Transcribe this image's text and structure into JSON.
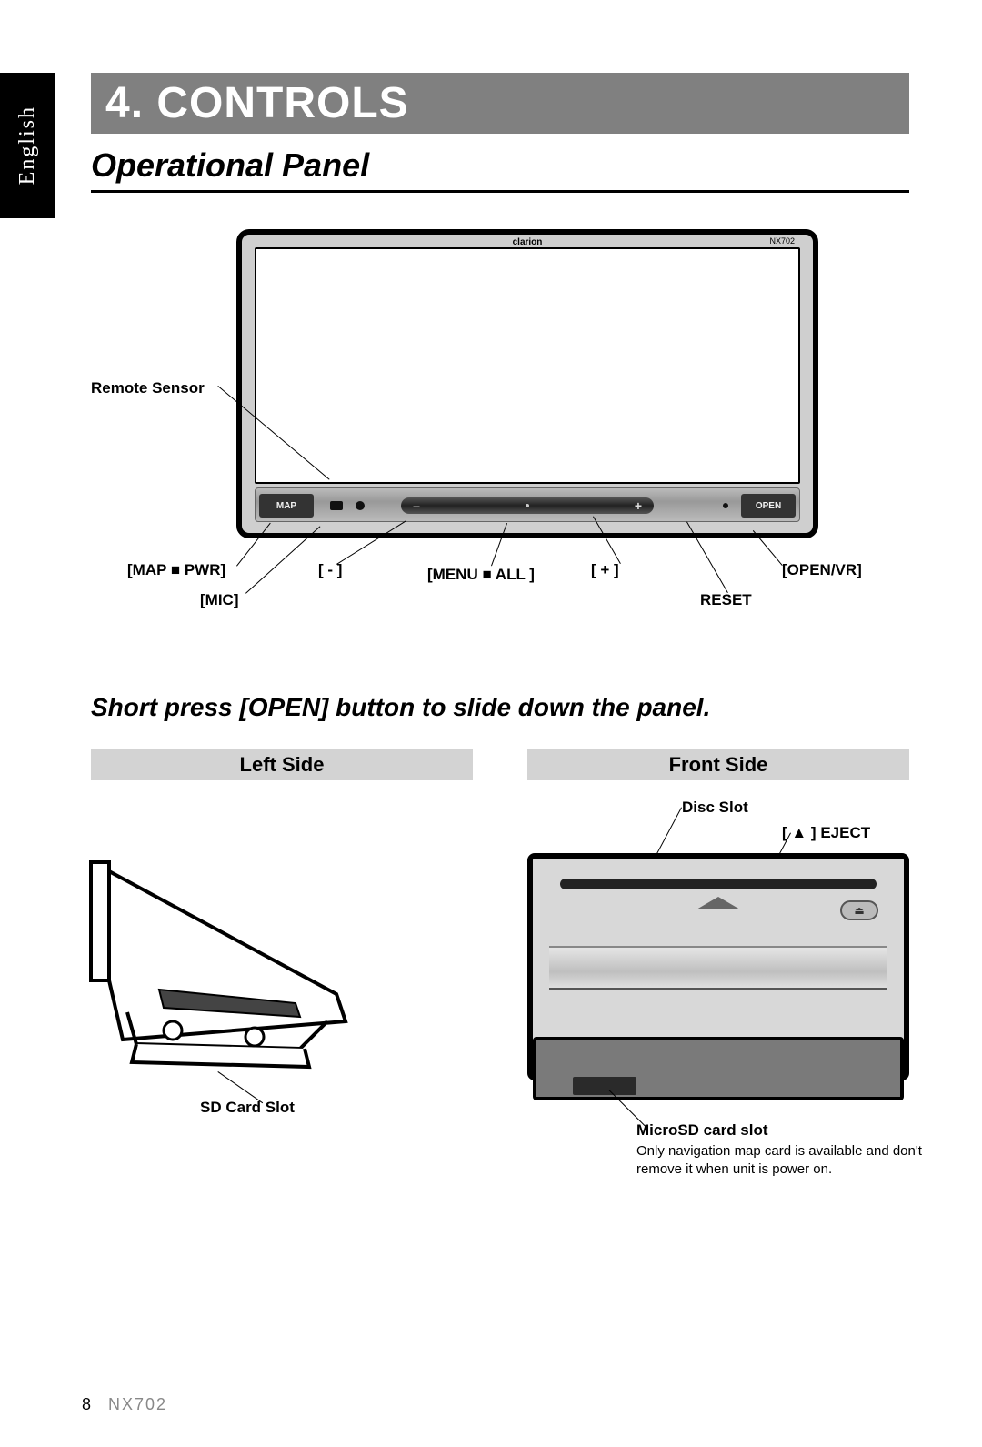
{
  "language_tab": "English",
  "chapter": {
    "number": "4.",
    "title": "CONTROLS"
  },
  "section_title": "Operational Panel",
  "device": {
    "brand": "clarion",
    "model": "NX702",
    "button_map_label": "MAP",
    "button_open_label": "OPEN"
  },
  "diagram1_callouts": {
    "remote_sensor": "Remote Sensor",
    "map_pwr": "[MAP ■ PWR]",
    "mic": "[MIC]",
    "minus": "[ - ]",
    "menu_all": "[MENU ■ ALL ]",
    "plus": "[ + ]",
    "open_vr": "[OPEN/VR]",
    "reset": "RESET"
  },
  "subtitle": "Short press [OPEN] button to slide down the panel.",
  "side_headers": {
    "left": "Left Side",
    "front": "Front Side"
  },
  "left_side": {
    "sd_card": "SD Card Slot"
  },
  "front_side": {
    "disc_slot": "Disc Slot",
    "eject": "[ ▲ ] EJECT",
    "eject_glyph": "⏏",
    "microsd_title": "MicroSD card slot",
    "microsd_note": "Only navigation map card is available and don't remove it when unit is power on."
  },
  "footer": {
    "page": "8",
    "model": "NX702"
  }
}
